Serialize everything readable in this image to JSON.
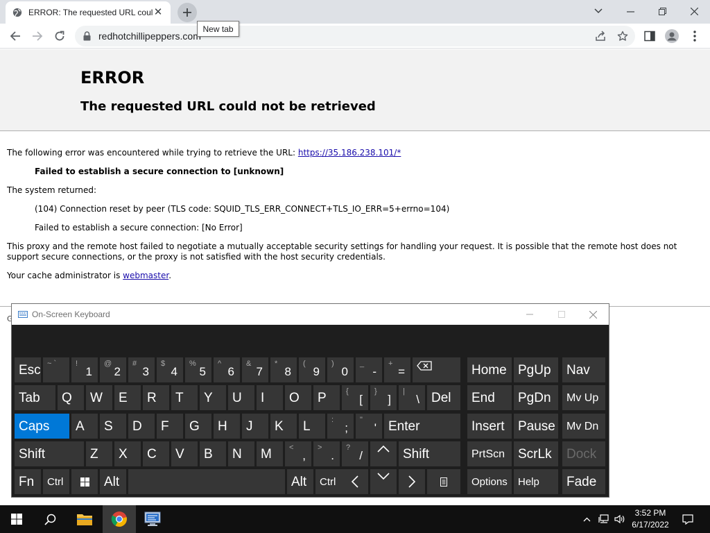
{
  "browser": {
    "tab_title": "ERROR: The requested URL could not be retrieved",
    "tooltip": "New tab",
    "url": "redhotchillipeppers.com"
  },
  "page": {
    "title": "ERROR",
    "subtitle": "The requested URL could not be retrieved",
    "intro_text": "The following error was encountered while trying to retrieve the URL: ",
    "intro_link": "https://35.186.238.101/*",
    "error_detail": "Failed to establish a secure connection to [unknown]",
    "system_returned": "The system returned:",
    "sys_line1": "(104) Connection reset by peer (TLS code: SQUID_TLS_ERR_CONNECT+TLS_IO_ERR=5+errno=104)",
    "sys_line2": "Failed to establish a secure connection: [No Error]",
    "explanation": "This proxy and the remote host failed to negotiate a mutually acceptable security settings for handling your request. It is possible that the remote host does not support secure connections, or the proxy is not satisfied with the host security credentials.",
    "admin_prefix": "Your cache administrator is ",
    "admin_link": "webmaster",
    "admin_suffix": ".",
    "footer_fragment": "G"
  },
  "osk": {
    "title": "On-Screen Keyboard",
    "keys": {
      "esc": "Esc",
      "tilde_alt": "~ `",
      "k1_alt": "!",
      "k1": "1",
      "k2_alt": "@",
      "k2": "2",
      "k3_alt": "#",
      "k3": "3",
      "k4_alt": "$",
      "k4": "4",
      "k5_alt": "%",
      "k5": "5",
      "k6_alt": "^",
      "k6": "6",
      "k7_alt": "&",
      "k7": "7",
      "k8_alt": "*",
      "k8": "8",
      "k9_alt": "(",
      "k9": "9",
      "k0_alt": ")",
      "k0": "0",
      "minus_alt": "_",
      "minus": "-",
      "equals_alt": "+",
      "equals": "=",
      "home": "Home",
      "pgup": "PgUp",
      "nav": "Nav",
      "tab": "Tab",
      "q": "Q",
      "w": "W",
      "e": "E",
      "r": "R",
      "t": "T",
      "y": "Y",
      "u": "U",
      "i": "I",
      "o": "O",
      "p": "P",
      "lbrace_alt": "{",
      "lbrace": "[",
      "rbrace_alt": "}",
      "rbrace": "]",
      "pipe_alt": "|",
      "backslash": "\\",
      "del": "Del",
      "end": "End",
      "pgdn": "PgDn",
      "mvup": "Mv Up",
      "caps": "Caps",
      "a": "A",
      "s": "S",
      "d": "D",
      "f": "F",
      "g": "G",
      "h": "H",
      "j": "J",
      "k": "K",
      "l": "L",
      "colon_alt": ":",
      "semicolon": ";",
      "quote_alt": "\"",
      "quote": "'",
      "enter": "Enter",
      "insert": "Insert",
      "pause": "Pause",
      "mvdn": "Mv Dn",
      "shift": "Shift",
      "z": "Z",
      "x": "X",
      "c": "C",
      "v": "V",
      "b": "B",
      "n": "N",
      "m": "M",
      "lt_alt": "<",
      "comma": ",",
      "gt_alt": ">",
      "period": ".",
      "q_alt": "?",
      "slash": "/",
      "shift_r": "Shift",
      "prtscn": "PrtScn",
      "scrlk": "ScrLk",
      "dock": "Dock",
      "fn": "Fn",
      "ctrl": "Ctrl",
      "alt": "Alt",
      "alt_r": "Alt",
      "ctrl_r": "Ctrl",
      "options": "Options",
      "help": "Help",
      "fade": "Fade"
    }
  },
  "taskbar": {
    "time": "3:52 PM",
    "date": "6/17/2022"
  },
  "colors": {
    "accent": "#0078d7",
    "link": "#1a0dab"
  }
}
